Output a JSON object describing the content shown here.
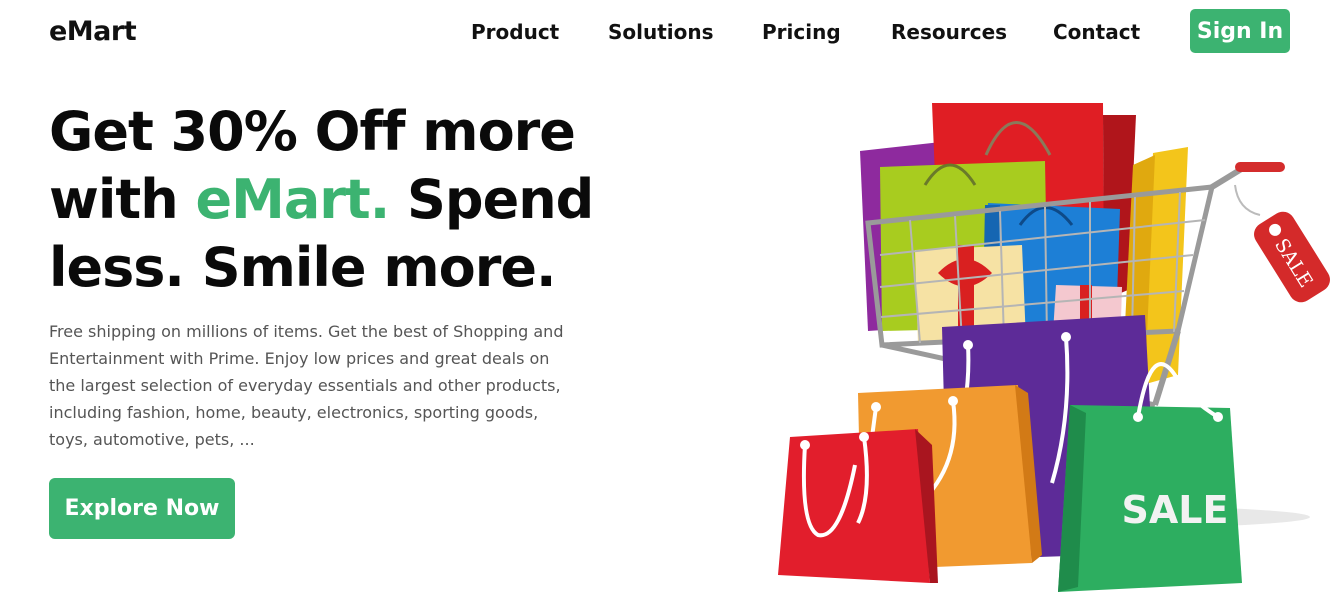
{
  "navbar": {
    "logo": "eMart",
    "links": [
      "Product",
      "Solutions",
      "Pricing",
      "Resources",
      "Contact"
    ],
    "signin_label": "Sign In"
  },
  "hero": {
    "title_part1": "Get 30% Off more with ",
    "title_accent": "eMart.",
    "title_part2": " Spend less. Smile more.",
    "description": "Free shipping on millions of items. Get the best of Shopping and Entertainment with Prime. Enjoy low prices and great deals on the largest selection of everyday essentials and other products, including fashion, home, beauty, electronics, sporting goods, toys, automotive, pets, ...",
    "cta_label": "Explore Now",
    "illustration": {
      "bag_label": "SALE",
      "tag_label": "SALE"
    }
  },
  "colors": {
    "brand": "#3cb371",
    "text": "#111111",
    "muted": "#555555"
  }
}
